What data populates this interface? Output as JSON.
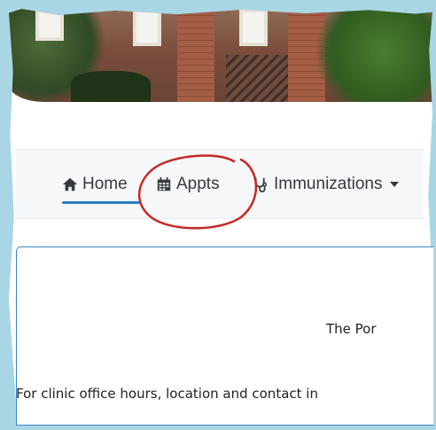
{
  "nav": {
    "home": {
      "label": "Home",
      "icon": "home-icon"
    },
    "appts": {
      "label": "Appts",
      "icon": "calendar-icon"
    },
    "immunizations": {
      "label": "Immunizations",
      "icon": "stethoscope-icon"
    },
    "accent_color": "#2b7ec1"
  },
  "annotation": {
    "color": "#c62828"
  },
  "panel": {
    "title": "The Por",
    "text": "For clinic office hours, location and contact in"
  }
}
